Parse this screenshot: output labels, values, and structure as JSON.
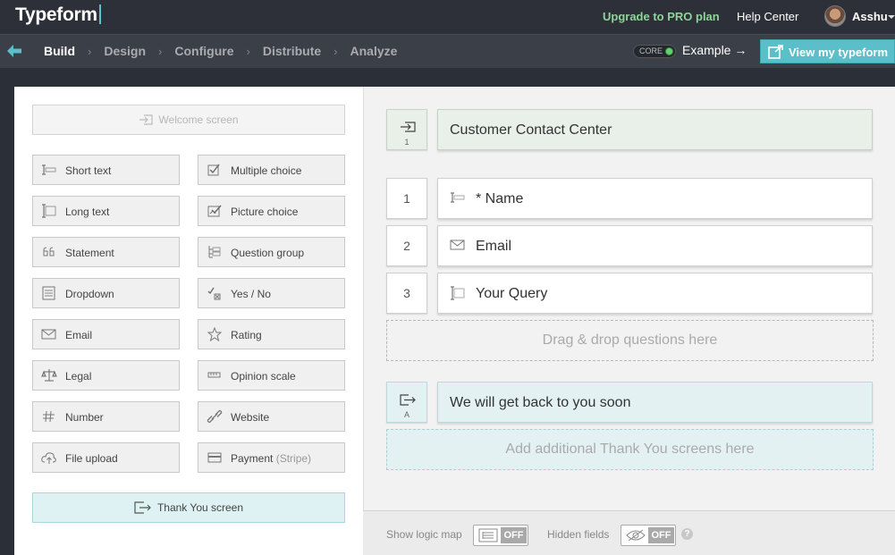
{
  "header": {
    "logo": "Typeform",
    "upgrade_label": "Upgrade to PRO plan",
    "help_label": "Help Center",
    "user_name": "Asshu"
  },
  "nav": {
    "steps": [
      "Build",
      "Design",
      "Configure",
      "Distribute",
      "Analyze"
    ],
    "active_step": "Build",
    "core_label": "CORE",
    "example_label": "Example →",
    "view_label": "View my typeform"
  },
  "builder": {
    "welcome_label": "Welcome screen",
    "question_types": [
      {
        "label": "Short text",
        "icon": "short-text-icon"
      },
      {
        "label": "Multiple choice",
        "icon": "multiple-choice-icon"
      },
      {
        "label": "Long text",
        "icon": "long-text-icon"
      },
      {
        "label": "Picture choice",
        "icon": "picture-choice-icon"
      },
      {
        "label": "Statement",
        "icon": "quote-icon"
      },
      {
        "label": "Question group",
        "icon": "question-group-icon"
      },
      {
        "label": "Dropdown",
        "icon": "dropdown-icon"
      },
      {
        "label": "Yes / No",
        "icon": "yes-no-icon"
      },
      {
        "label": "Email",
        "icon": "envelope-icon"
      },
      {
        "label": "Rating",
        "icon": "star-icon"
      },
      {
        "label": "Legal",
        "icon": "scales-icon"
      },
      {
        "label": "Opinion scale",
        "icon": "scale-icon"
      },
      {
        "label": "Number",
        "icon": "hash-icon"
      },
      {
        "label": "Website",
        "icon": "link-icon"
      },
      {
        "label": "File upload",
        "icon": "cloud-upload-icon"
      },
      {
        "label": "Payment",
        "sub": "(Stripe)",
        "icon": "credit-card-icon"
      }
    ],
    "thankyou_label": "Thank You screen"
  },
  "form": {
    "welcome": {
      "number": "1",
      "title": "Customer Contact Center"
    },
    "questions": [
      {
        "number": "1",
        "title": "* Name",
        "icon": "short-text-icon"
      },
      {
        "number": "2",
        "title": "Email",
        "icon": "envelope-icon"
      },
      {
        "number": "3",
        "title": "Your Query",
        "icon": "long-text-icon"
      }
    ],
    "drop_hint": "Drag & drop questions here",
    "thankyou": {
      "letter": "A",
      "title": "We will get back to you soon"
    },
    "add_thankyou_hint": "Add additional Thank You screens here"
  },
  "footer": {
    "logic_map_label": "Show logic map",
    "logic_map_state": "OFF",
    "hidden_fields_label": "Hidden fields",
    "hidden_fields_state": "OFF",
    "help": "?"
  },
  "colors": {
    "accent": "#5bbfc9",
    "upgrade": "#8fd49a",
    "welcome_bg": "#e8f0e9",
    "thankyou_bg": "#e3f1f2"
  }
}
